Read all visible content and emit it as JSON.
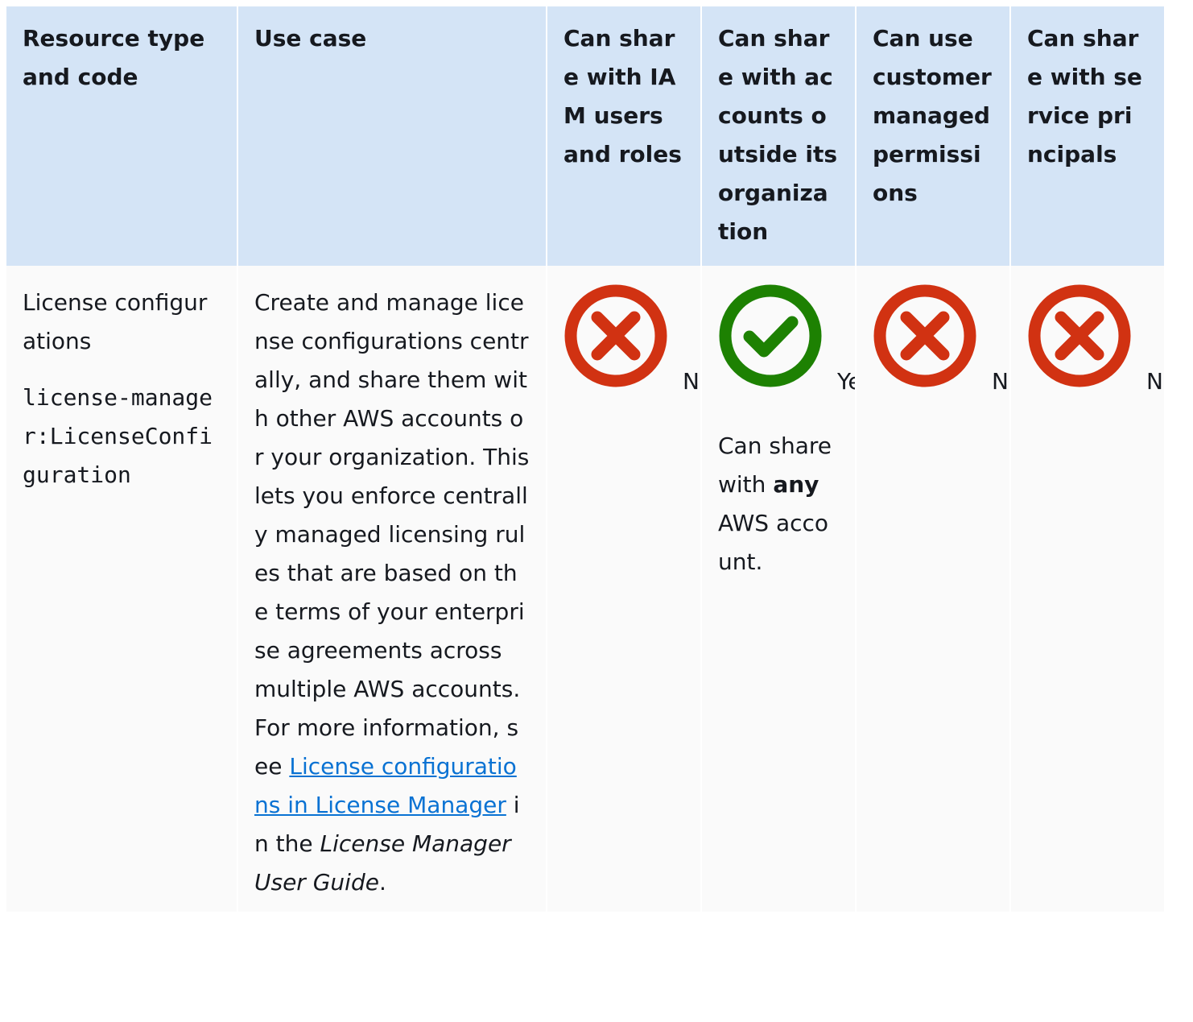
{
  "headers": [
    "Resource type and code",
    "Use case",
    "Can share with IAM users and roles",
    "Can share with accounts outside its organization",
    "Can use customer managed permissions",
    "Can share with service principals"
  ],
  "row": {
    "resource_type": "License configurations",
    "resource_code": "license-manager:LicenseConfiguration",
    "use_case": {
      "text": "Create and manage license configurations centrally, and share them with other AWS accounts or your organization. This lets you enforce centrally managed licensing rules that are based on the terms of your enterprise agreements across multiple AWS accounts. For more information, see ",
      "link_text": "License configurations in License Manager",
      "after_link": " in the ",
      "guide_title": "License Manager User Guide",
      "end": "."
    },
    "iam_users_roles": {
      "icon": "error-icon",
      "label": "No"
    },
    "outside_org": {
      "icon": "success-icon",
      "label": "Yes",
      "note_prefix": "Can share with ",
      "note_bold": "any",
      "note_suffix": " AWS account."
    },
    "customer_managed_permissions": {
      "icon": "error-icon",
      "label": "No"
    },
    "service_principals": {
      "icon": "error-icon",
      "label": "No"
    }
  },
  "colors": {
    "header_bg": "#d4e4f6",
    "row_bg": "#fafafa",
    "error": "#d13212",
    "success": "#1d8102",
    "link": "#0972d3"
  }
}
